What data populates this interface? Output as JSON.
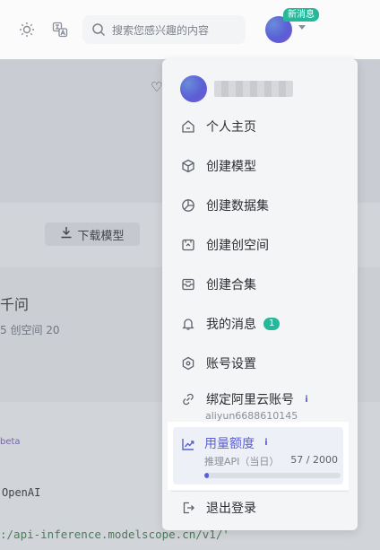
{
  "header": {
    "search_placeholder": "搜索您感兴趣的内容",
    "new_message_badge": "新消息",
    "icons": [
      "sun-icon",
      "translate-icon",
      "search-icon",
      "chevron-down-icon"
    ]
  },
  "background": {
    "download_label": "下载模型",
    "title_fragment": "千问",
    "stats_fragment": "5 创空间 20",
    "beta_fragment": "beta",
    "openai_fragment": "OpenAI",
    "code_fragment": ":/api-inference.modelscope.cn/v1/'"
  },
  "menu": {
    "items": [
      {
        "label": "个人主页",
        "icon": "home-icon"
      },
      {
        "label": "创建模型",
        "icon": "cube-icon"
      },
      {
        "label": "创建数据集",
        "icon": "dataset-icon"
      },
      {
        "label": "创建创空间",
        "icon": "studio-icon"
      },
      {
        "label": "创建合集",
        "icon": "collection-icon"
      },
      {
        "label": "我的消息",
        "icon": "bell-icon",
        "count": "1"
      },
      {
        "label": "账号设置",
        "icon": "settings-icon"
      },
      {
        "label": "绑定阿里云账号",
        "icon": "link-icon",
        "sub": "aliyun6688610145"
      },
      {
        "label": "退出登录",
        "icon": "logout-icon"
      }
    ],
    "quota": {
      "title": "用量额度",
      "subtitle": "推理API（当日）",
      "used": 57,
      "total": 2000,
      "count_text": "57 / 2000",
      "fraction": 0.0285
    }
  },
  "colors": {
    "accent": "#5a5fd6",
    "badge": "#26b89a"
  }
}
